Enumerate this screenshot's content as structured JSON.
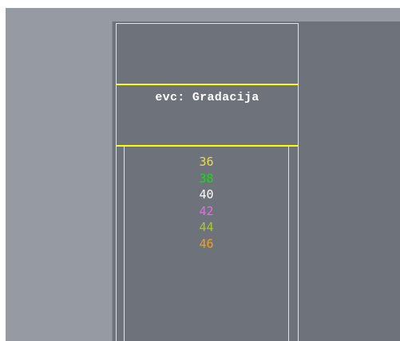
{
  "panel": {
    "title": "evc: Gradacija"
  },
  "values": [
    {
      "label": "36",
      "color": "#e6e04a"
    },
    {
      "label": "38",
      "color": "#22d422"
    },
    {
      "label": "40",
      "color": "#ffffff"
    },
    {
      "label": "42",
      "color": "#e070e0"
    },
    {
      "label": "44",
      "color": "#a8c83a"
    },
    {
      "label": "46",
      "color": "#f0a020"
    }
  ],
  "colors": {
    "frame": "#ffff00",
    "panel_bg": "#6e727a",
    "backdrop": "#969aa3"
  }
}
